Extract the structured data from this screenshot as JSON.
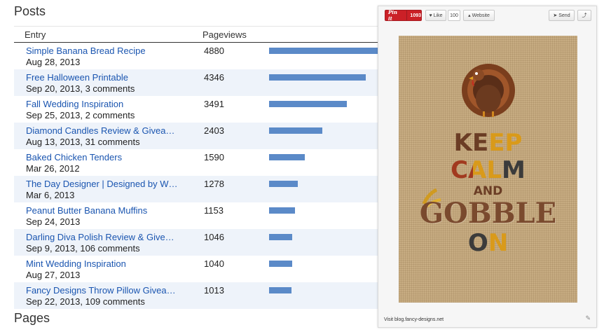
{
  "posts_title": "Posts",
  "pages_title": "Pages",
  "table": {
    "col_entry": "Entry",
    "col_pageviews": "Pageviews",
    "max_pageviews": 4880,
    "rows": [
      {
        "title": "Simple Banana Bread Recipe",
        "sub": "Aug 28, 2013",
        "pageviews": 4880
      },
      {
        "title": "Free Halloween Printable",
        "sub": "Sep 20, 2013, 3 comments",
        "pageviews": 4346
      },
      {
        "title": "Fall Wedding Inspiration",
        "sub": "Sep 25, 2013, 2 comments",
        "pageviews": 3491
      },
      {
        "title": "Diamond Candles Review & Givea…",
        "sub": "Aug 13, 2013, 31 comments",
        "pageviews": 2403
      },
      {
        "title": "Baked Chicken Tenders",
        "sub": "Mar 26, 2012",
        "pageviews": 1590
      },
      {
        "title": "The Day Designer | Designed by W…",
        "sub": "Mar 6, 2013",
        "pageviews": 1278
      },
      {
        "title": "Peanut Butter Banana Muffins",
        "sub": "Sep 24, 2013",
        "pageviews": 1153
      },
      {
        "title": "Darling Diva Polish Review & Give…",
        "sub": "Sep 9, 2013, 106 comments",
        "pageviews": 1046
      },
      {
        "title": "Mint Wedding Inspiration",
        "sub": "Aug 27, 2013",
        "pageviews": 1040
      },
      {
        "title": "Fancy Designs Throw Pillow Givea…",
        "sub": "Sep 22, 2013, 109 comments",
        "pageviews": 1013
      }
    ]
  },
  "pin_panel": {
    "pin_label": "Pin it",
    "pin_count": "1093",
    "like_label": "Like",
    "like_count": "100",
    "website_label": "Website",
    "send_label": "Send",
    "poster": {
      "keep": "KEEP",
      "calm": "CALM",
      "and": "AND",
      "gobble": "GOBBLE",
      "on": "ON"
    },
    "footer": "Visit blog.fancy-designs.net"
  },
  "colors": {
    "link": "#1a55b0",
    "bar": "#5b8ac8",
    "alt_row": "#eef3fa",
    "pinterest_red": "#cb2027"
  }
}
